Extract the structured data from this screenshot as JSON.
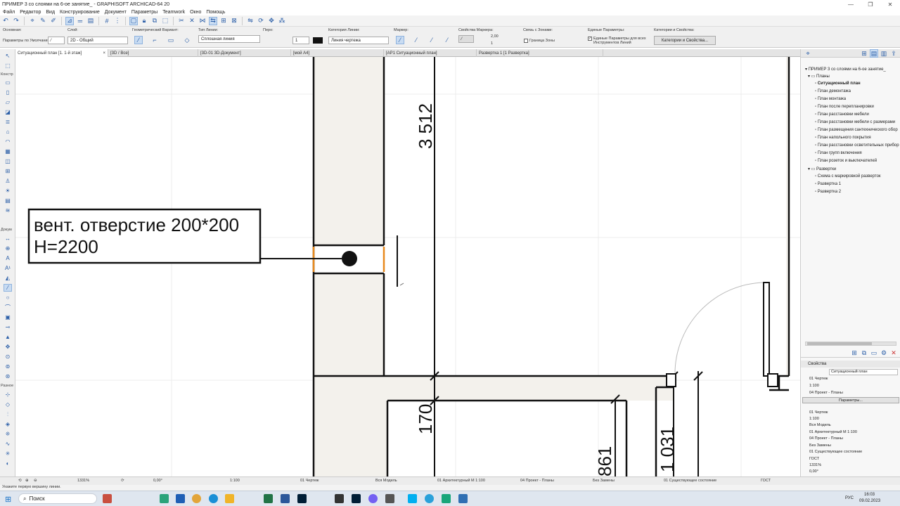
{
  "window": {
    "title": "ПРИМЕР 3 со слоями на 6-ое занятие_ - GRAPHISOFT ARCHICAD-64 20"
  },
  "menu": [
    "Файл",
    "Редактор",
    "Вид",
    "Конструирование",
    "Документ",
    "Параметры",
    "Teamwork",
    "Окно",
    "Помощь"
  ],
  "infobox": {
    "osnovnaya": "Основная:",
    "params_default": "Параметры по Умолчанию",
    "sloy_label": "Слой:",
    "sloy_value": "2D - Общий",
    "geom_label": "Геометрический Вариант:",
    "line_type_label": "Тип Линии:",
    "line_type_value": "Сплошная линия",
    "pero_label": "Перо:",
    "pero_value": "1",
    "category_label": "Категория Линии:",
    "category_value": "Линия чертежа",
    "marker_label": "Маркер:",
    "marker_props_label": "Свойства Маркера:",
    "marker_size": "2,00",
    "marker_val": "1",
    "zone_link_label": "Связь с Зонами:",
    "zone_border": "Граница Зоны",
    "unified_label": "Единые Параметры:",
    "unified_value": "Единые Параметры для всех Инструментов Линий",
    "categories_label": "Категории и Свойства:",
    "categories_button": "Категории и Свойства..."
  },
  "tabs": [
    {
      "label": "Ситуационный план  [1. 1-й этаж]",
      "active": true
    },
    {
      "label": "[3D / Все]"
    },
    {
      "label": "[3D-01 3D-Документ]"
    },
    {
      "label": "[мой А4]"
    },
    {
      "label": "[АР1 Ситуационный план]"
    },
    {
      "label": "Развертка 1 [1 Развертка]"
    }
  ],
  "toolbox": {
    "konstr": "Констр",
    "dokum": "Докум",
    "razno": "Разное"
  },
  "drawing": {
    "label_line1": "вент. отверстие 200*200",
    "label_line2": "H=2200",
    "dim_3512": "3 512",
    "dim_170": "170",
    "dim_861": "861",
    "dim_1031": "1 031"
  },
  "navigator": {
    "root": "ПРИМЕР 3 со слоями на 6-ое занятие_",
    "plans_folder": "Планы",
    "plans": [
      "Ситуационный план",
      "План демонтажа",
      "План монтажа",
      "План после перепланировки",
      "План расстановки мебели",
      "План расстановки мебели с размерами",
      "План размещения сантехнического обор",
      "План напольного покрытия",
      "План расстановки осветительных прибор",
      "План групп включения",
      "План розеток и выключателей"
    ],
    "razv_folder": "Развертки",
    "razv": [
      "Схема с маркировкой разверток",
      "Развертка 1",
      "Развертка 2"
    ]
  },
  "properties": {
    "title": "Свойства",
    "name_value": "Ситуационный план",
    "rows": [
      "01 Чертеж",
      "1:100",
      "04 Проект - Планы"
    ],
    "params_button": "Параметры...",
    "rows2": [
      "01 Чертеж",
      "1:100",
      "Вся Модель",
      "01 Архитектурный М 1:100",
      "04 Проект - Планы",
      "Без Замены",
      "01 Существующее состояние",
      "ГОСТ",
      "1331%",
      "0,00°"
    ]
  },
  "statusbar": {
    "zoom": "1331%",
    "angle": "0,00°",
    "scale": "1:100",
    "layerset": "01 Чертеж",
    "model": "Вся Модель",
    "penset": "01 Архитектурный М 1:100",
    "viewset": "04 Проект - Планы",
    "override": "Без Замены",
    "renovation": "01 Существующее состояние",
    "standard": "ГОСТ"
  },
  "hint": "Укажите первую вершину линии.",
  "taskbar": {
    "search": "Поиск",
    "lang": "РУС",
    "time": "16:03",
    "date": "09.02.2023"
  },
  "colors": {
    "accent": "#2c5fa8",
    "wall_fill": "#f3f1ec",
    "highlight": "#e8891d"
  }
}
